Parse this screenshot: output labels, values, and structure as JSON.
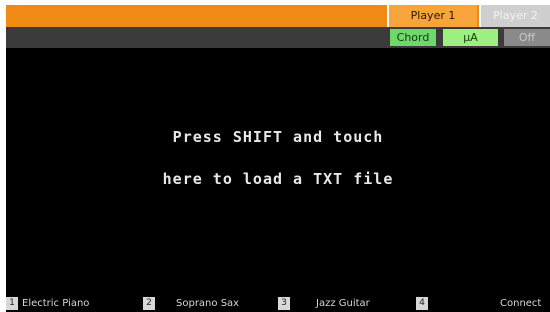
{
  "header": {
    "player1_label": "Player 1",
    "player2_label": "Player 2"
  },
  "toolbar": {
    "chord_label": "Chord",
    "hold_label": "µA",
    "off_label": "Off"
  },
  "main": {
    "line1": "Press SHIFT and touch",
    "line2": "here to load a TXT file"
  },
  "footer": {
    "tracks": [
      {
        "num": "1",
        "name": "Electric Piano"
      },
      {
        "num": "2",
        "name": "Soprano Sax"
      },
      {
        "num": "3",
        "name": "Jazz Guitar"
      },
      {
        "num": "4",
        "name": ""
      }
    ],
    "connect_label": "Connect"
  },
  "colors": {
    "top_bar": "#ef8a14",
    "active_tab": "#f7a53a",
    "chord_pill": "#6fd86a",
    "screen_bg": "#000000"
  }
}
